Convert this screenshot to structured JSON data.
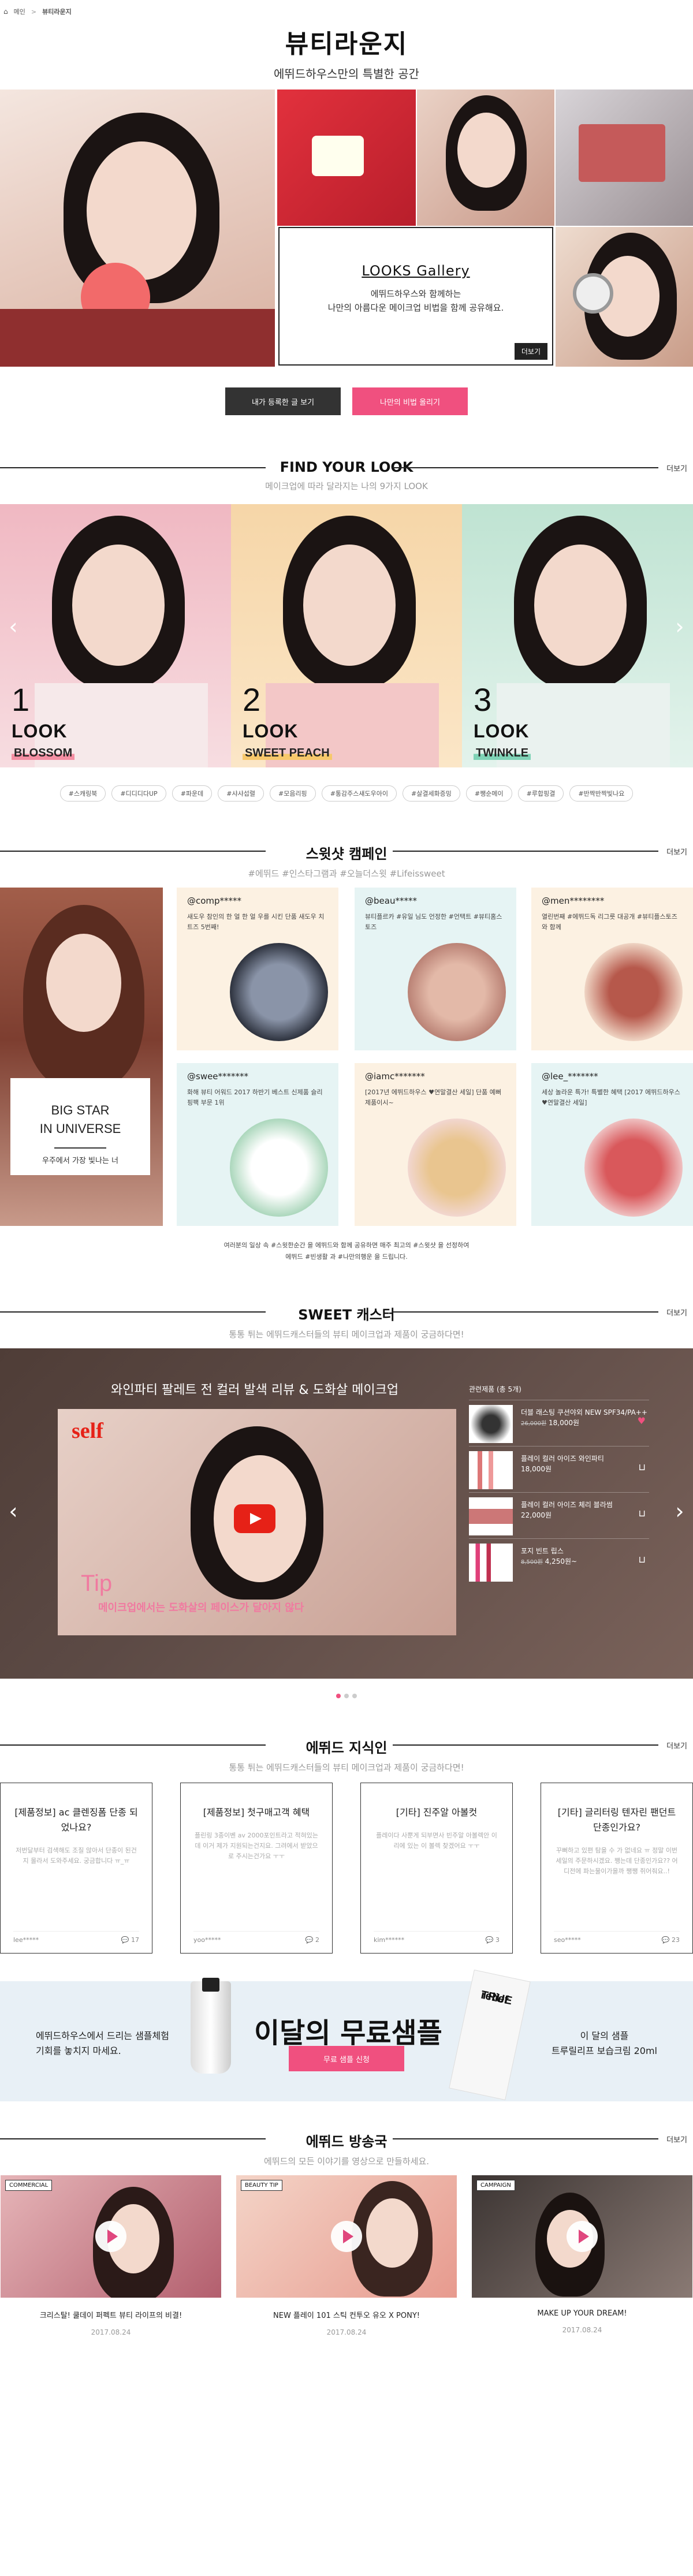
{
  "breadcrumb": {
    "home": "메인",
    "separator": ">",
    "current": "뷰티라운지"
  },
  "header": {
    "title": "뷰티라운지",
    "subtitle": "에뛰드하우스만의 특별한 공간"
  },
  "gallery": {
    "looks_title": "LOOKS Gallery",
    "looks_desc_1": "에뛰드하우스와 함께하는",
    "looks_desc_2": "나만의 아름다운 메이크업 비법을 함께 공유해요.",
    "more": "더보기"
  },
  "actions": {
    "my_posts": "내가 등록한 글 보기",
    "share": "나만의 비법 올리기"
  },
  "find_look": {
    "title": "FIND YOUR LOOK",
    "subtitle": "메이크업에 따라 달라지는 나의 9가지 LOOK",
    "more": "더보기",
    "panels": [
      {
        "num": "1",
        "label": "LOOK",
        "sub": "BLOSSOM"
      },
      {
        "num": "2",
        "label": "LOOK",
        "sub": "SWEET PEACH"
      },
      {
        "num": "3",
        "label": "LOOK",
        "sub": "TWINKLE"
      }
    ],
    "prev": "‹",
    "next": "›"
  },
  "tags": [
    "#스캐링북",
    "#디디디다UP",
    "#파운데",
    "#샤샤섭렬",
    "#모음리핑",
    "#통감주스섀도우아이",
    "#살결세화증밍",
    "#쨍순메이",
    "#루합핑결",
    "#반짝반짝빛나요"
  ],
  "campaign": {
    "title": "스윗샷 캠페인",
    "subtitle": "#에뛰드 #인스타그램과 #오늘더스윗 #Lifeissweet",
    "more": "더보기",
    "star_title_1": "BIG STAR",
    "star_title_2": "IN UNIVERSE",
    "star_sub": "우주에서 가장 빛나는 너",
    "cards": [
      {
        "user": "@comp*****",
        "text": "새도우 참인의 한 얼 한 얼 우를 시킨 단품 새도우 치트즈 5번째!"
      },
      {
        "user": "@beau*****",
        "text": "뷰티플르카 #유일 님도 언정한 #언택트 #뷰티홈스토즈"
      },
      {
        "user": "@men********",
        "text": "열린번째 #에뛰드독 리그릇 대공개 #뷰티플스토즈 와 함께"
      },
      {
        "user": "@swee*******",
        "text": "화해 뷰티 어워드 2017 하반기 베스트 신제품 슬리핑팩 부문 1위"
      },
      {
        "user": "@iamc*******",
        "text": "[2017년 에뛰드하우스 ♥연말결산 세일] 단품 예뻐 제품이시~"
      },
      {
        "user": "@lee_*******",
        "text": "세상 놀라운 특가! 특별한 혜택 [2017 에뛰드하우스 ♥연말결산 세일]"
      }
    ],
    "note_1": "여러분의 일상 속 #스윗한순간 을 에뛰드와 함께 공유하면 매주 최고의 #스윗샷 을 선정하여",
    "note_2": "에뛰드 #빈생활 과 #나만의행운 을 드립니다."
  },
  "caster": {
    "title": "SWEET 캐스터",
    "subtitle": "통통 튀는 에뛰드캐스터들의 뷰티 메이크업과 제품이 궁금하다면!",
    "more": "더보기",
    "video_title": "와인파티 팔레트 전 컬러 발색 리뷰 & 도화살 메이크업",
    "video_brand": "self",
    "video_tip": "Tip",
    "video_caption": "메이크업에서는 도화살의 페이스가 달아지 않다",
    "related_title": "관련제품 (총 5개)",
    "products": [
      {
        "name": "더블 래스팅 쿠션야외 NEW SPF34/PA++",
        "old": "26,000원",
        "price": "18,000원"
      },
      {
        "name": "플레이 컬러 아이즈 와인파티",
        "old": "",
        "price": "18,000원"
      },
      {
        "name": "플레이 컬러 아이즈 체리 블라썸",
        "old": "",
        "price": "22,000원"
      },
      {
        "name": "포지 빈트 립스",
        "old": "8,500원",
        "price": "4,250원~"
      }
    ]
  },
  "knowledge": {
    "title": "에뛰드 지식인",
    "subtitle": "통통 튀는 에뛰드캐스터들의 뷰티 메이크업과 제품이 궁금하다면!",
    "more": "더보기",
    "cards": [
      {
        "q": "[제품정보] ac 클렌징폼 단종 되었나요?",
        "a": "저번달부터 검색해도 조질 않아서 단종이 된건지 몰라서 도와주세요. 궁금합니다 ㅠ_ㅠ",
        "user": "lee*****",
        "count": "17"
      },
      {
        "q": "[제품정보] 첫구매고객 혜택",
        "a": "플린링 3종이벤 av 2000포인트라고 적혀있는데 이거 제가 지원되는건지요. 그려에서 받았으로 주시는건가요 ㅜㅜ",
        "user": "yoo*****",
        "count": "2"
      },
      {
        "q": "[기타] 진주알 아볼컷",
        "a": "플레이다 사뿐게 되부면사 빈주알 아볼렉안 이리에 있는 이 볼렉 찾겠어요 ㅜㅜ",
        "user": "kim******",
        "count": "3"
      },
      {
        "q": "[기타] 글리터링 텐자린 팬던트 단종인가요?",
        "a": "꾸뻐하고 있편 탐을 수 가 없네요 ㅠ 정말 이번 세일의 주문하시겠요. 쨍는데 단종인가요?? 어디전에 파는물이가을까 쨍쨍 쥐어줘요..!",
        "user": "seo*****",
        "count": "23"
      }
    ]
  },
  "sample": {
    "left_1": "에뛰드하우스에서 드리는 샘플체험",
    "left_2": "기회를 놓치지 마세요.",
    "title": "이달의 무료샘플",
    "button": "무료 샘플 신청",
    "right_1": "이 달의 샘플",
    "right_2": "트루릴리프 보습크림 20ml",
    "product_name_1": "TRUE",
    "product_name_2": "relief"
  },
  "broadcast": {
    "title": "에뛰드 방송국",
    "subtitle": "에뛰드의 모든 이야기를 영상으로 만들하세요.",
    "more": "더보기",
    "videos": [
      {
        "tag": "COMMERCIAL",
        "title": "크리스탈! 쿨데이 퍼펙트 뷰티 라이프의 비결!",
        "date": "2017.08.24"
      },
      {
        "tag": "BEAUTY TIP",
        "title": "NEW 플레이 101 스틱 컨투오 유오 X PONY!",
        "date": "2017.08.24"
      },
      {
        "tag": "CAMPAIGN",
        "title": "MAKE UP YOUR DREAM!",
        "date": "2017.08.24"
      }
    ]
  },
  "colors": {
    "accent": "#f0507f",
    "dark": "#333333"
  }
}
